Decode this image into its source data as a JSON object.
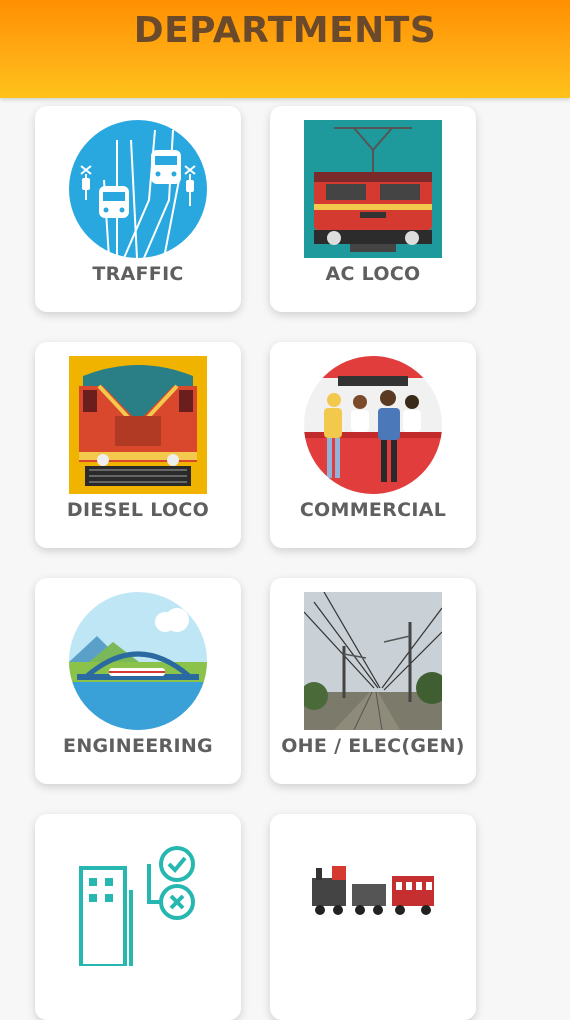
{
  "header": {
    "title": "DEPARTMENTS"
  },
  "departments": [
    {
      "label": "TRAFFIC",
      "icon": "traffic-trains-icon"
    },
    {
      "label": "AC LOCO",
      "icon": "electric-locomotive-icon"
    },
    {
      "label": "DIESEL LOCO",
      "icon": "diesel-locomotive-icon"
    },
    {
      "label": "COMMERCIAL",
      "icon": "ticket-counter-icon"
    },
    {
      "label": "ENGINEERING",
      "icon": "bridge-train-icon"
    },
    {
      "label": "OHE / ELEC(GEN)",
      "icon": "overhead-lines-photo-icon"
    },
    {
      "label": "",
      "icon": "office-building-tasks-icon"
    },
    {
      "label": "",
      "icon": "freight-train-icon"
    }
  ],
  "colors": {
    "header": "#ffa000",
    "title": "#6a4a2a",
    "label": "#5f5f5f"
  }
}
